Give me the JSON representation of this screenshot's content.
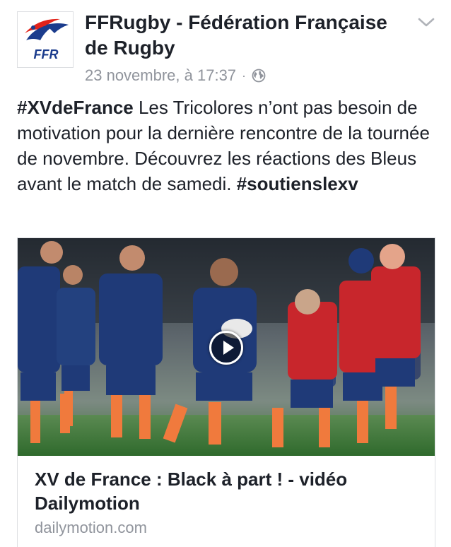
{
  "post": {
    "page_name": "FFRugby - Fédération Française de Rugby",
    "avatar_text": "FFR",
    "timestamp": "23 novembre, à 17:37",
    "separator": "·",
    "audience_icon": "globe-icon",
    "options_icon": "chevron-down-icon",
    "text": {
      "hashtag_1": "#XVdeFrance",
      "body": " Les Tricolores n’ont pas besoin de motivation pour la dernière rencontre de la tournée de novembre. Découvrez les réactions des Bleus avant le match de samedi. ",
      "hashtag_2": "#soutienslexv"
    }
  },
  "link_card": {
    "title": "XV de France : Black à part ! - vidéo Dailymotion",
    "domain": "dailymotion.com",
    "play_icon": "play-icon"
  },
  "colors": {
    "text_primary": "#1d2129",
    "text_secondary": "#90949c",
    "border": "#dddfe2",
    "ffr_blue": "#1b3c8d",
    "ffr_red": "#e2231a",
    "kit_navy": "#1f3a78",
    "bib_red": "#c8262c",
    "socks_orange": "#f07a3d",
    "grass": "#3f7d3a"
  }
}
